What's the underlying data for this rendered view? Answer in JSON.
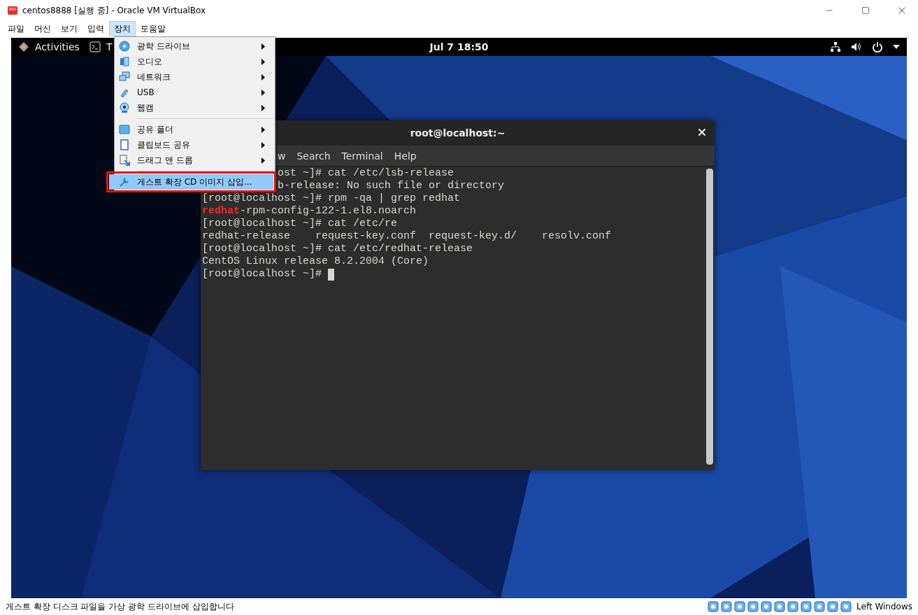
{
  "window": {
    "title": "centos8888 [실행 중] - Oracle VM VirtualBox"
  },
  "menu_bar": [
    {
      "label": "파일",
      "selected": false
    },
    {
      "label": "머신",
      "selected": false
    },
    {
      "label": "보기",
      "selected": false
    },
    {
      "label": "입력",
      "selected": false
    },
    {
      "label": "장치",
      "selected": true
    },
    {
      "label": "도움말",
      "selected": false
    }
  ],
  "devices_menu": {
    "items": [
      {
        "kind": "item",
        "label": "광학 드라이브",
        "submenu": true,
        "selected": false
      },
      {
        "kind": "item",
        "label": "오디오",
        "submenu": true,
        "selected": false
      },
      {
        "kind": "item",
        "label": "네트워크",
        "submenu": true,
        "selected": false
      },
      {
        "kind": "item",
        "label": "USB",
        "submenu": true,
        "selected": false
      },
      {
        "kind": "item",
        "label": "웹캠",
        "submenu": true,
        "selected": false
      },
      {
        "kind": "separator"
      },
      {
        "kind": "item",
        "label": "공유 폴더",
        "submenu": true,
        "selected": false
      },
      {
        "kind": "item",
        "label": "클립보드 공유",
        "submenu": true,
        "selected": false
      },
      {
        "kind": "item",
        "label": "드래그 앤 드롭",
        "submenu": true,
        "selected": false
      },
      {
        "kind": "separator"
      },
      {
        "kind": "item",
        "label": "게스트 확장 CD 이미지 삽입...",
        "submenu": false,
        "selected": true
      }
    ]
  },
  "guest": {
    "top_bar": {
      "activities": "Activities",
      "app": "T",
      "clock": "Jul 7  18:50"
    },
    "terminal": {
      "title": "root@localhost:~",
      "menu": [
        "w",
        "Search",
        "Terminal",
        "Help"
      ],
      "lines": [
        {
          "kind": "partial",
          "text": "ost ~]# cat /etc/lsb-release"
        },
        {
          "kind": "partial",
          "text": "b-release: No such file or directory"
        },
        {
          "kind": "full",
          "text": "[root@localhost ~]# rpm -qa | grep redhat"
        },
        {
          "kind": "full",
          "text": "**redhat**-rpm-config-122-1.el8.noarch"
        },
        {
          "kind": "full",
          "text": "[root@localhost ~]# cat /etc/re"
        },
        {
          "kind": "full",
          "text": "redhat-release    request-key.conf  request-key.d/    resolv.conf"
        },
        {
          "kind": "full",
          "text": "[root@localhost ~]# cat /etc/redhat-release"
        },
        {
          "kind": "full",
          "text": "CentOS Linux release 8.2.2004 (Core)"
        },
        {
          "kind": "full",
          "text": "[root@localhost ~]# ",
          "cursor": true
        }
      ]
    }
  },
  "status_bar": {
    "message": "게스트 확장 디스크 파일을 가상 광학 드라이브에 삽입합니다",
    "host_key": "Left Windows"
  }
}
